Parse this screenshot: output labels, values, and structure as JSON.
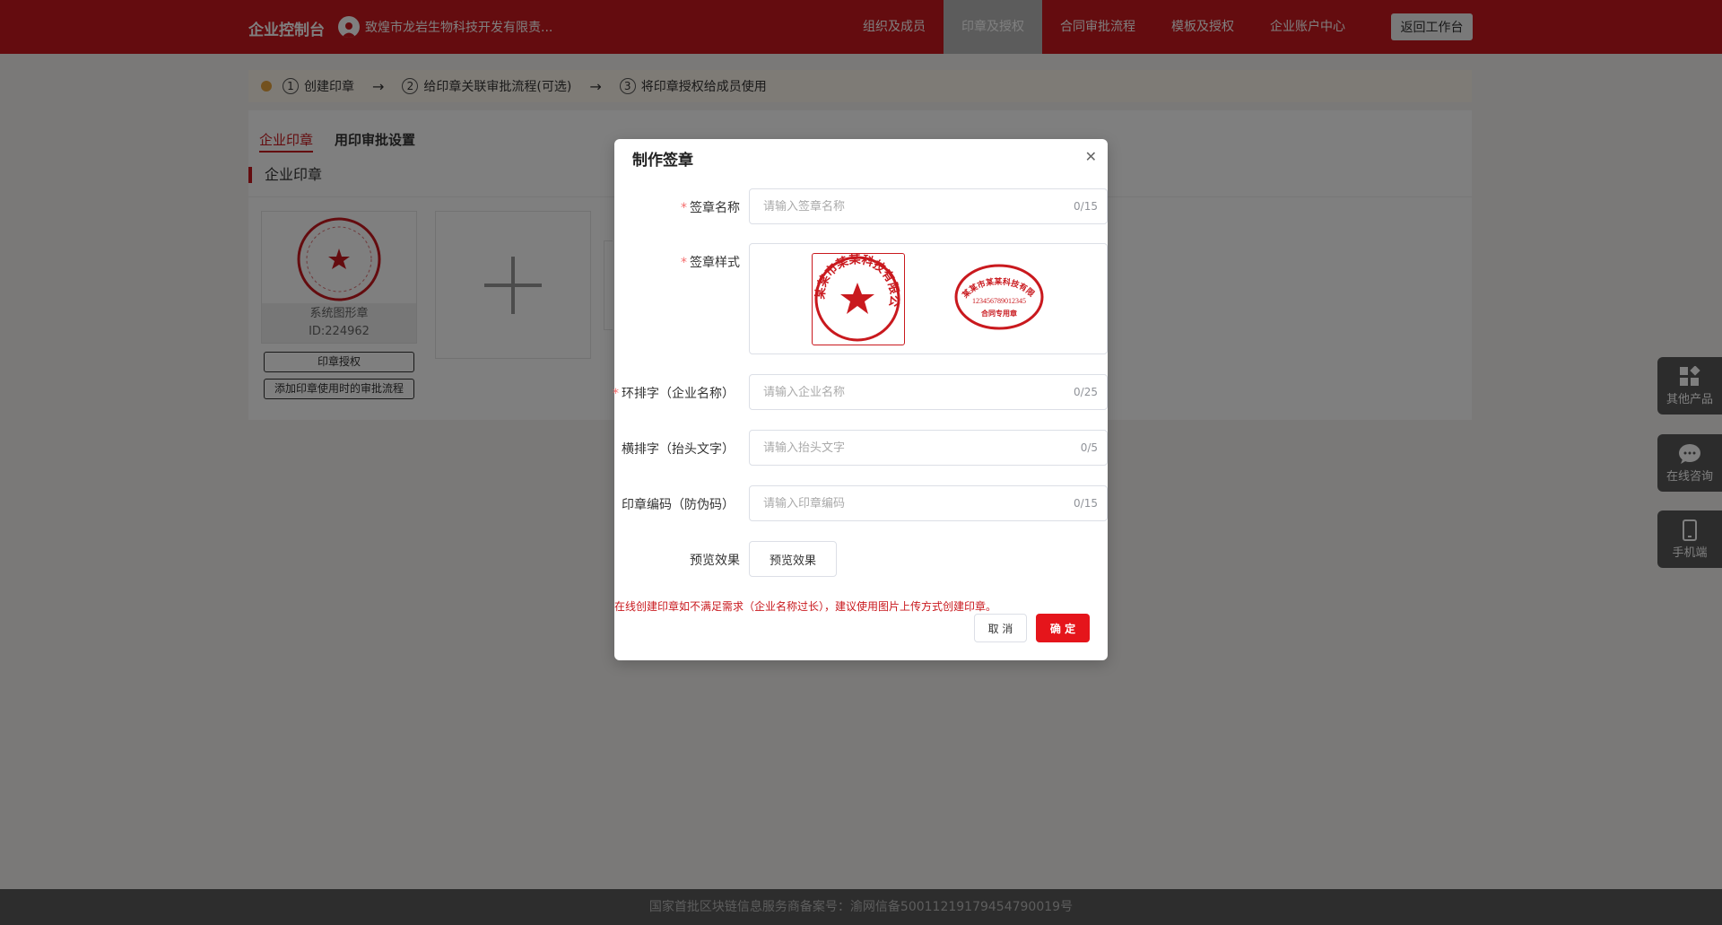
{
  "topbar": {
    "brand": "企业控制台",
    "company": "致煌市龙岩生物科技开发有限责...",
    "nav": [
      "组织及成员",
      "印章及授权",
      "合同审批流程",
      "模板及授权",
      "企业账户中心"
    ],
    "active_nav": "印章及授权",
    "back_button": "返回工作台"
  },
  "steps": [
    {
      "num": "1",
      "label": "创建印章"
    },
    {
      "num": "2",
      "label": "给印章关联审批流程(可选)"
    },
    {
      "num": "3",
      "label": "将印章授权给成员使用"
    }
  ],
  "tabs": [
    "企业印章",
    "用印审批设置"
  ],
  "section_title": "企业印章",
  "seal_card": {
    "name": "系统图形章",
    "id": "ID:224962",
    "btn_authorize": "印章授权",
    "btn_approval": "添加印章使用时的审批流程"
  },
  "float_buttons": [
    "其他产品",
    "在线咨询",
    "手机端"
  ],
  "footer": "国家首批区块链信息服务商备案号：渝网信备50011219179454790019号",
  "modal": {
    "title": "制作签章",
    "fields": {
      "name": {
        "label": "签章名称",
        "placeholder": "请输入签章名称",
        "count": "0/15",
        "required": true
      },
      "style": {
        "label": "签章样式",
        "required": true
      },
      "ring": {
        "label": "环排字（企业名称）",
        "placeholder": "请输入企业名称",
        "count": "0/25",
        "required": true
      },
      "horizontal": {
        "label": "横排字（抬头文字）",
        "placeholder": "请输入抬头文字",
        "count": "0/5",
        "required": false
      },
      "code": {
        "label": "印章编码（防伪码）",
        "placeholder": "请输入印章编码",
        "count": "0/15",
        "required": false
      },
      "preview": {
        "label": "预览效果",
        "button": "预览效果"
      }
    },
    "seal_styles": [
      {
        "ring_text": "某某市某某科技有限公司",
        "center": "★"
      },
      {
        "ring_text": "某某市某某科技有限公司",
        "middle": "123456789012345",
        "bottom": "合同专用章"
      }
    ],
    "hint": "在线创建印章如不满足需求（企业名称过长），建议使用图片上传方式创建印章。",
    "cancel": "取 消",
    "ok": "确 定"
  },
  "colors": {
    "brand_red": "#c9191e",
    "ok_red": "#e5151b",
    "required": "#f56c6c"
  }
}
